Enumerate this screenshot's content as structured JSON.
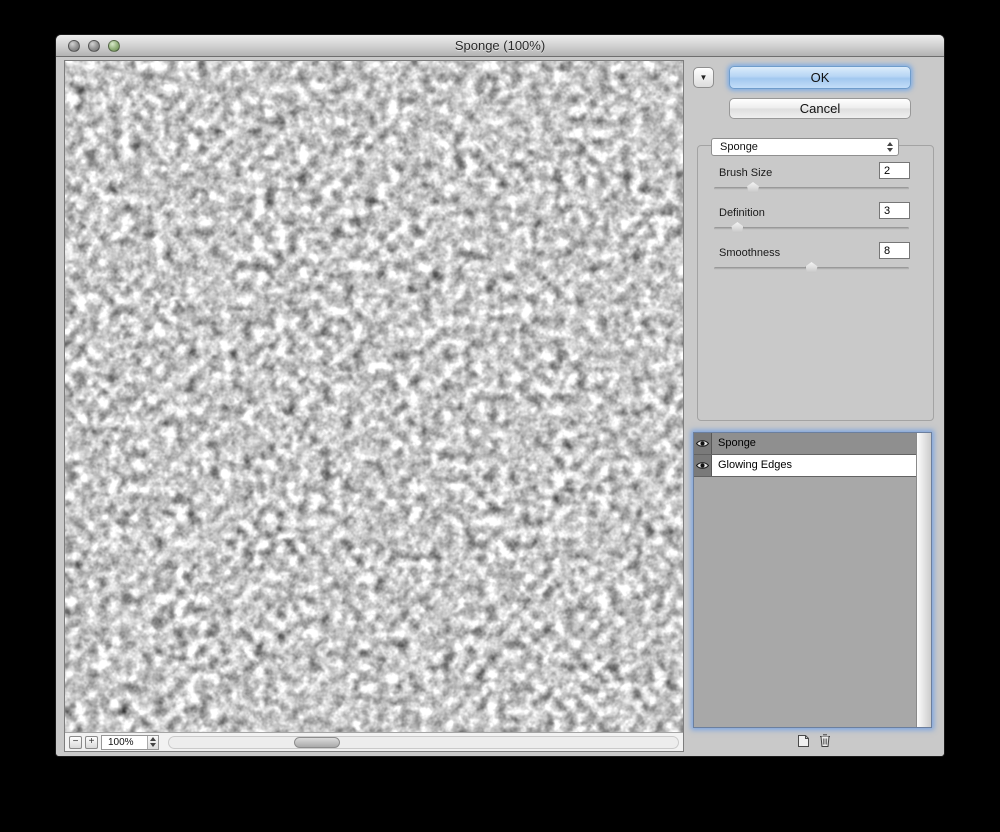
{
  "window": {
    "title": "Sponge (100%)"
  },
  "actions": {
    "ok": "OK",
    "cancel": "Cancel"
  },
  "filter_popup": {
    "value": "Sponge"
  },
  "controls": {
    "sliders": [
      {
        "label": "Brush Size",
        "value": "2",
        "min": 0,
        "max": 10
      },
      {
        "label": "Definition",
        "value": "3",
        "min": 0,
        "max": 25
      },
      {
        "label": "Smoothness",
        "value": "8",
        "min": 1,
        "max": 15
      }
    ]
  },
  "zoombar": {
    "minus": "−",
    "plus": "+",
    "zoom_value": "100%"
  },
  "layers": {
    "items": [
      {
        "name": "Sponge",
        "selected": true
      },
      {
        "name": "Glowing Edges",
        "selected": false
      }
    ]
  },
  "icons": {
    "disclosure": "▼",
    "eye": "eye",
    "new_effect_layer": "new-effect-layer",
    "delete_effect_layer": "trash"
  }
}
